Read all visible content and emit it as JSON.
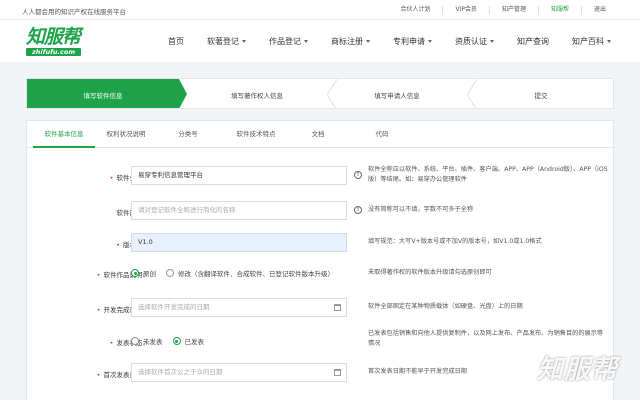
{
  "topbar": {
    "slogan": "人人都会用的知识产权在线服务平台",
    "links": [
      "合伙人计划",
      "VIP会员",
      "知产管理",
      "知服帮",
      "退出"
    ],
    "active_link": "知服帮"
  },
  "logo": {
    "cn": "知服帮",
    "en": "zhifufu.com"
  },
  "nav": {
    "items": [
      {
        "label": "首页",
        "has_dropdown": false
      },
      {
        "label": "软著登记",
        "has_dropdown": true
      },
      {
        "label": "作品登记",
        "has_dropdown": true
      },
      {
        "label": "商标注册",
        "has_dropdown": true
      },
      {
        "label": "专利申请",
        "has_dropdown": true
      },
      {
        "label": "资质认证",
        "has_dropdown": true
      },
      {
        "label": "知产查询",
        "has_dropdown": false
      },
      {
        "label": "知产百科",
        "has_dropdown": true
      }
    ]
  },
  "steps": [
    "填写软件信息",
    "填写著作权人信息",
    "填写申请人信息",
    "提交"
  ],
  "tabs": [
    "软件基本信息",
    "权利状况说明",
    "分类号",
    "软件技术特点",
    "文档",
    "代码"
  ],
  "form": {
    "software_name": {
      "label": "软件全称：",
      "value": "易穿专利信息管理平台",
      "hint": "软件全称应以软件、系统、平台、插件、客户端、APP、APP（Android版）、APP（iOS版）等结尾。如：易穿办公管理软件"
    },
    "software_short_name": {
      "label": "软件简称：",
      "placeholder": "请对登记软件全称进行简化的名称",
      "hint": "没有简称可以不填，字数不可多于全称"
    },
    "version": {
      "label": "版本号：",
      "value": "V1.0",
      "hint": "填写规范：大写V+版本号或不加V的版本号，如V1.0或1.0格式"
    },
    "work_description": {
      "label": "软件作品说明：",
      "options": [
        "原创",
        "修改（含翻译软件、合成软件、已登记软件版本升级）"
      ],
      "selected": "原创",
      "hint": "未取得著作权的软件版本升级请勾选原创即可"
    },
    "completion_date": {
      "label": "开发完成日期：",
      "placeholder": "选择软件开发完成的日期",
      "hint": "软件全部固定在某种物质载体（如硬盘、光盘）上的日期"
    },
    "publish_status": {
      "label": "发表状态：",
      "options": [
        "未发表",
        "已发表"
      ],
      "selected": "已发表",
      "hint": "已发表包括销售和向他人提供复制件，以及网上发布、产品发布、为销售目的的展示等情况"
    },
    "first_publish_date": {
      "label": "首次发表日期：",
      "placeholder": "选择软件首次公之于众的日期",
      "hint": "首次发表日期不能早于开发完成日期"
    }
  },
  "watermark": "知服帮"
}
